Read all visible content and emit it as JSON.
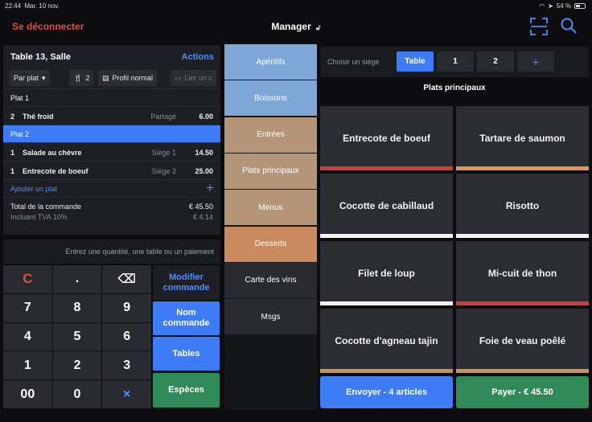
{
  "status": {
    "time": "22:44",
    "date": "Mar. 10 nov.",
    "battery": "54 %",
    "battery_level": 0.54
  },
  "nav": {
    "logout": "Se déconnecter",
    "title": "Manager"
  },
  "order": {
    "table_name": "Table 13, Salle",
    "actions": "Actions",
    "chips": {
      "mode": "Par plat",
      "guests": "2",
      "profile": "Profil normal",
      "link": "Lier un c"
    },
    "courses": [
      {
        "label": "Plat 1",
        "active": false,
        "lines": [
          {
            "qty": "2",
            "name": "Thé froid",
            "seat": "Partagé",
            "price": "6.00"
          }
        ]
      },
      {
        "label": "Plat 2",
        "active": true,
        "lines": [
          {
            "qty": "1",
            "name": "Salade au chèvre",
            "seat": "Siège 1",
            "price": "14.50"
          },
          {
            "qty": "1",
            "name": "Entrecote de boeuf",
            "seat": "Siège 2",
            "price": "25.00"
          }
        ]
      }
    ],
    "add_dish": "Ajouter un plat",
    "total_label": "Total de la commande",
    "total_value": "€ 45.50",
    "vat_label": "Incluant TVA 10%",
    "vat_value": "€ 4.14"
  },
  "keypad": {
    "prompt": "Entrez une quantité, une table ou un paiement",
    "keys": [
      "C",
      ".",
      "⌫",
      "7",
      "8",
      "9",
      "4",
      "5",
      "6",
      "1",
      "2",
      "3",
      "00",
      "0",
      "×"
    ],
    "modify": "Modifier commande",
    "name_order": "Nom commande",
    "tables": "Tables",
    "cash": "Espèces"
  },
  "categories": [
    {
      "label": "Apéritifs",
      "color": "#7ea6d6"
    },
    {
      "label": "Boissons",
      "color": "#7ea6d6"
    },
    {
      "label": "Entrées",
      "color": "#b59578"
    },
    {
      "label": "Plats principaux",
      "color": "#b59578"
    },
    {
      "label": "Menus",
      "color": "#b59578"
    },
    {
      "label": "Desserts",
      "color": "#c98a5e"
    },
    {
      "label": "Carte des vins",
      "color": "#2a2b30"
    },
    {
      "label": "Msgs",
      "color": "#2a2b30"
    }
  ],
  "seats": {
    "label": "Choisir un siège",
    "options": [
      "Table",
      "1",
      "2",
      "+"
    ]
  },
  "menu": {
    "title": "Plats principaux",
    "dishes": [
      {
        "name": "Entrecote de boeuf",
        "color": "#d33a3a"
      },
      {
        "name": "Tartare de saumon",
        "color": "#e39455"
      },
      {
        "name": "Cocotte de cabillaud",
        "color": "#f2f2f2"
      },
      {
        "name": "Risotto",
        "color": "#f2f2f2"
      },
      {
        "name": "Filet de loup",
        "color": "#f2f2f2"
      },
      {
        "name": "Mi-cuit de thon",
        "color": "#d33a3a"
      },
      {
        "name": "Cocotte d'agneau tajin",
        "color": "#c9925a"
      },
      {
        "name": "Foie de veau poêlé",
        "color": "#c9925a"
      }
    ],
    "send": "Envoyer - 4 articles",
    "pay": "Payer - € 45.50"
  }
}
